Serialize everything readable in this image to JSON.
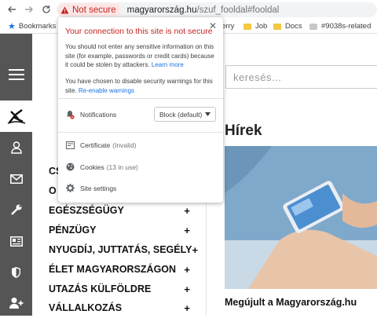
{
  "browser": {
    "security_chip": "Not secure",
    "url_host": "magyarország.hu",
    "url_path": "/szuf_fooldal#fooldal",
    "bookmarks": [
      {
        "label": "Bookmarks",
        "icon": "star-icon"
      },
      {
        "label": "erry",
        "icon": "folder-icon"
      },
      {
        "label": "Job",
        "icon": "folder-icon"
      },
      {
        "label": "Docs",
        "icon": "folder-icon"
      },
      {
        "label": "#9038s-related",
        "icon": "folder-icon"
      }
    ]
  },
  "popup": {
    "title": "Your connection to this site is not secure",
    "warning_text": "You should not enter any sensitive information on this site (for example, passwords or credit cards) because it could be stolen by attackers.",
    "learn_more": "Learn more",
    "disabled_text": "You have chosen to disable security warnings for this site.",
    "reenable": "Re-enable warnings",
    "notifications_label": "Notifications",
    "notifications_value": "Block (default)",
    "certificate_label": "Certificate",
    "certificate_status": "(Invalid)",
    "cookies_label": "Cookies",
    "cookies_status": "(13 in use)",
    "site_settings": "Site settings"
  },
  "page": {
    "search_placeholder": "keresés...",
    "news_heading": "Hírek",
    "news_caption": "Megújult a Magyarország.hu",
    "menu": [
      {
        "label": "CS",
        "plus": ""
      },
      {
        "label": "O",
        "plus": ""
      },
      {
        "label": "EGÉSZSÉGÜGY",
        "plus": "+"
      },
      {
        "label": "PÉNZÜGY",
        "plus": "+"
      },
      {
        "label": "NYUGDÍJ, JUTTATÁS, SEGÉLY",
        "plus": "+"
      },
      {
        "label": "ÉLET MAGYARORSZÁGON",
        "plus": "+"
      },
      {
        "label": "UTAZÁS KÜLFÖLDRE",
        "plus": "+"
      },
      {
        "label": "VÁLLALKOZÁS",
        "plus": "+"
      }
    ]
  }
}
